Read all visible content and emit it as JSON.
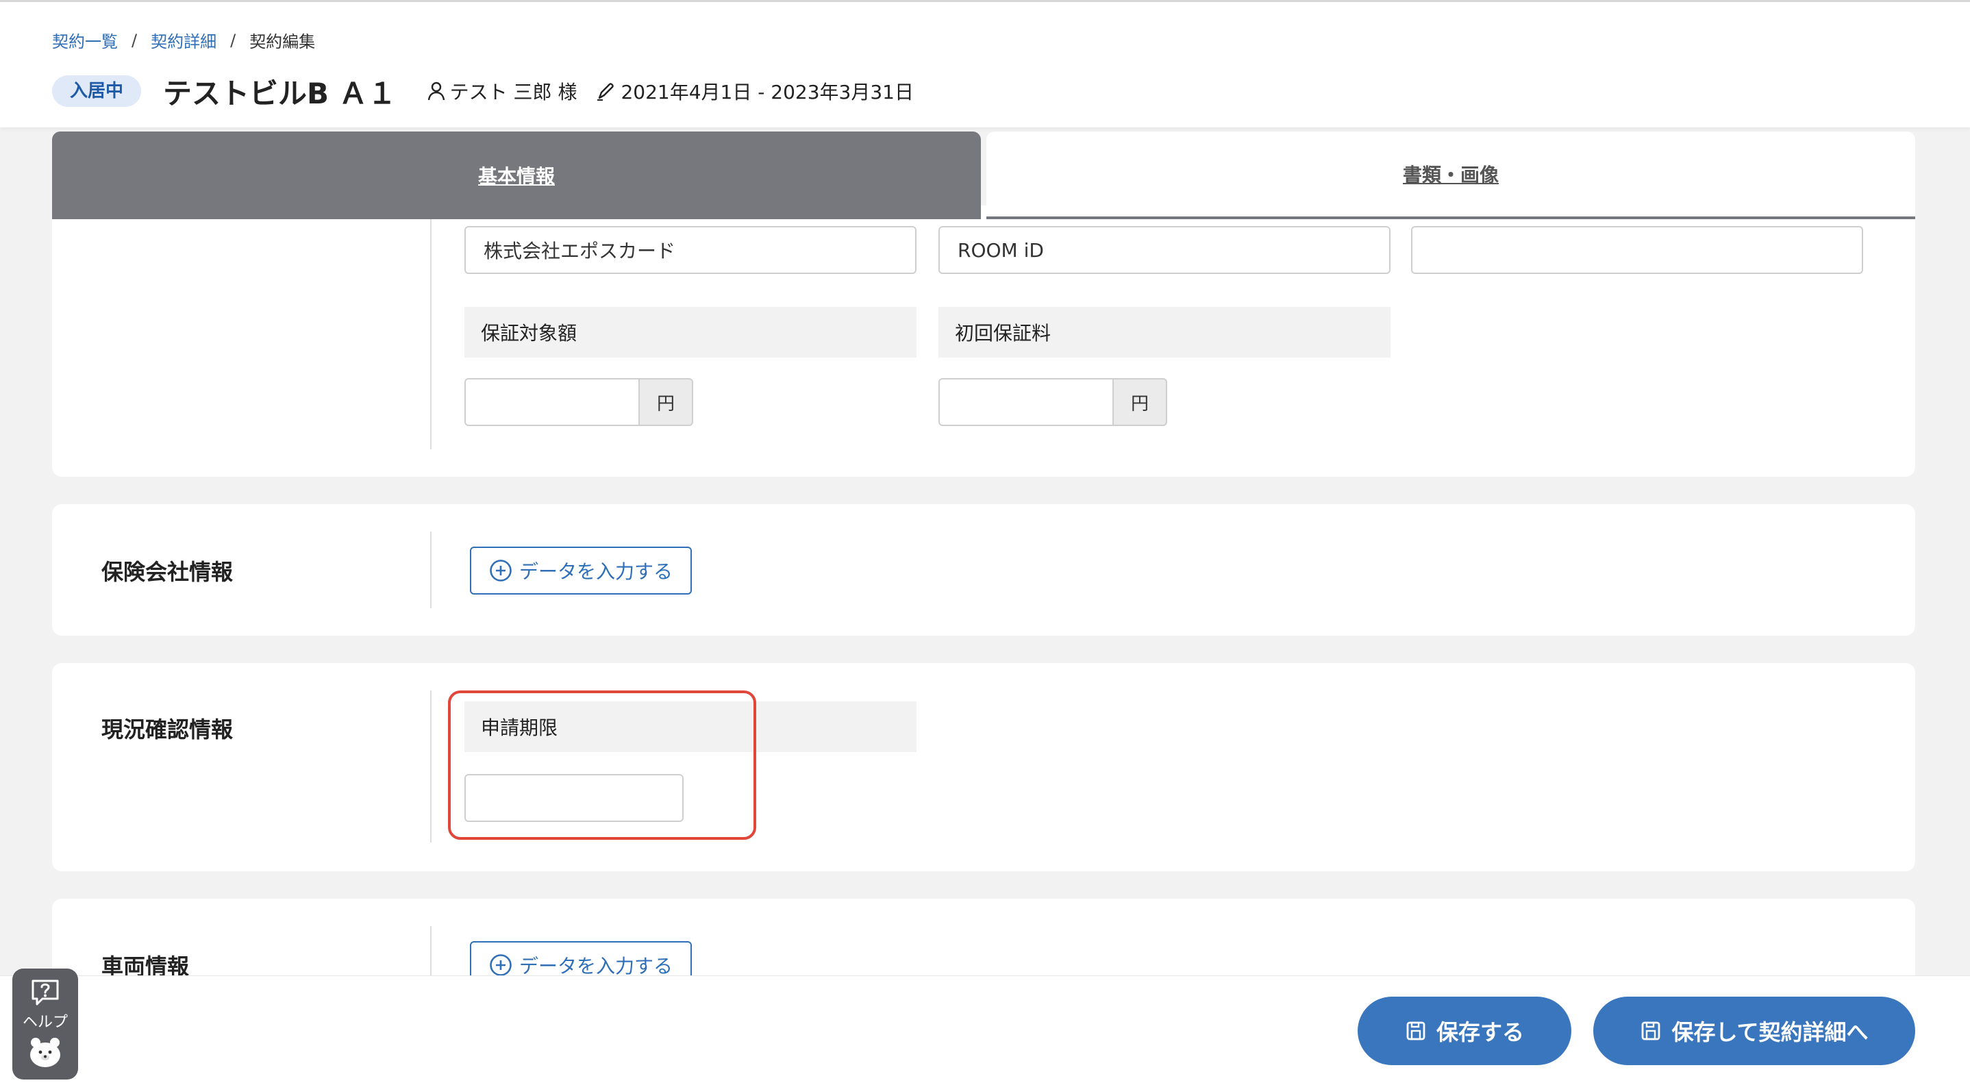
{
  "breadcrumb": {
    "items": [
      "契約一覧",
      "契約詳細"
    ],
    "separator": "/",
    "current": "契約編集"
  },
  "header": {
    "status_badge": "入居中",
    "title": "テストビルB Ａ１",
    "tenant": "テスト 三郎 様",
    "period": "2021年4月1日 - 2023年3月31日"
  },
  "tabs": [
    {
      "label": "基本情報",
      "active": true
    },
    {
      "label": "書類・画像",
      "active": false
    }
  ],
  "guarantee": {
    "fields": [
      {
        "value": "株式会社エポスカード"
      },
      {
        "value": "ROOM iD"
      },
      {
        "value": ""
      }
    ],
    "target_amount_label": "保証対象額",
    "initial_fee_label": "初回保証料",
    "unit": "円"
  },
  "insurance": {
    "title": "保険会社情報",
    "add_label": "データを入力する"
  },
  "status_check": {
    "title": "現況確認情報",
    "deadline_label": "申請期限",
    "deadline_value": ""
  },
  "vehicle": {
    "title": "車両情報",
    "add_label": "データを入力する"
  },
  "footer": {
    "save_label": "保存する",
    "save_detail_label": "保存して契約詳細へ"
  },
  "help": {
    "label": "ヘルプ"
  },
  "colors": {
    "accent": "#3a76be",
    "tab_active": "#77777e",
    "highlight": "#e0463a",
    "badge_bg": "#dfe9f7"
  }
}
